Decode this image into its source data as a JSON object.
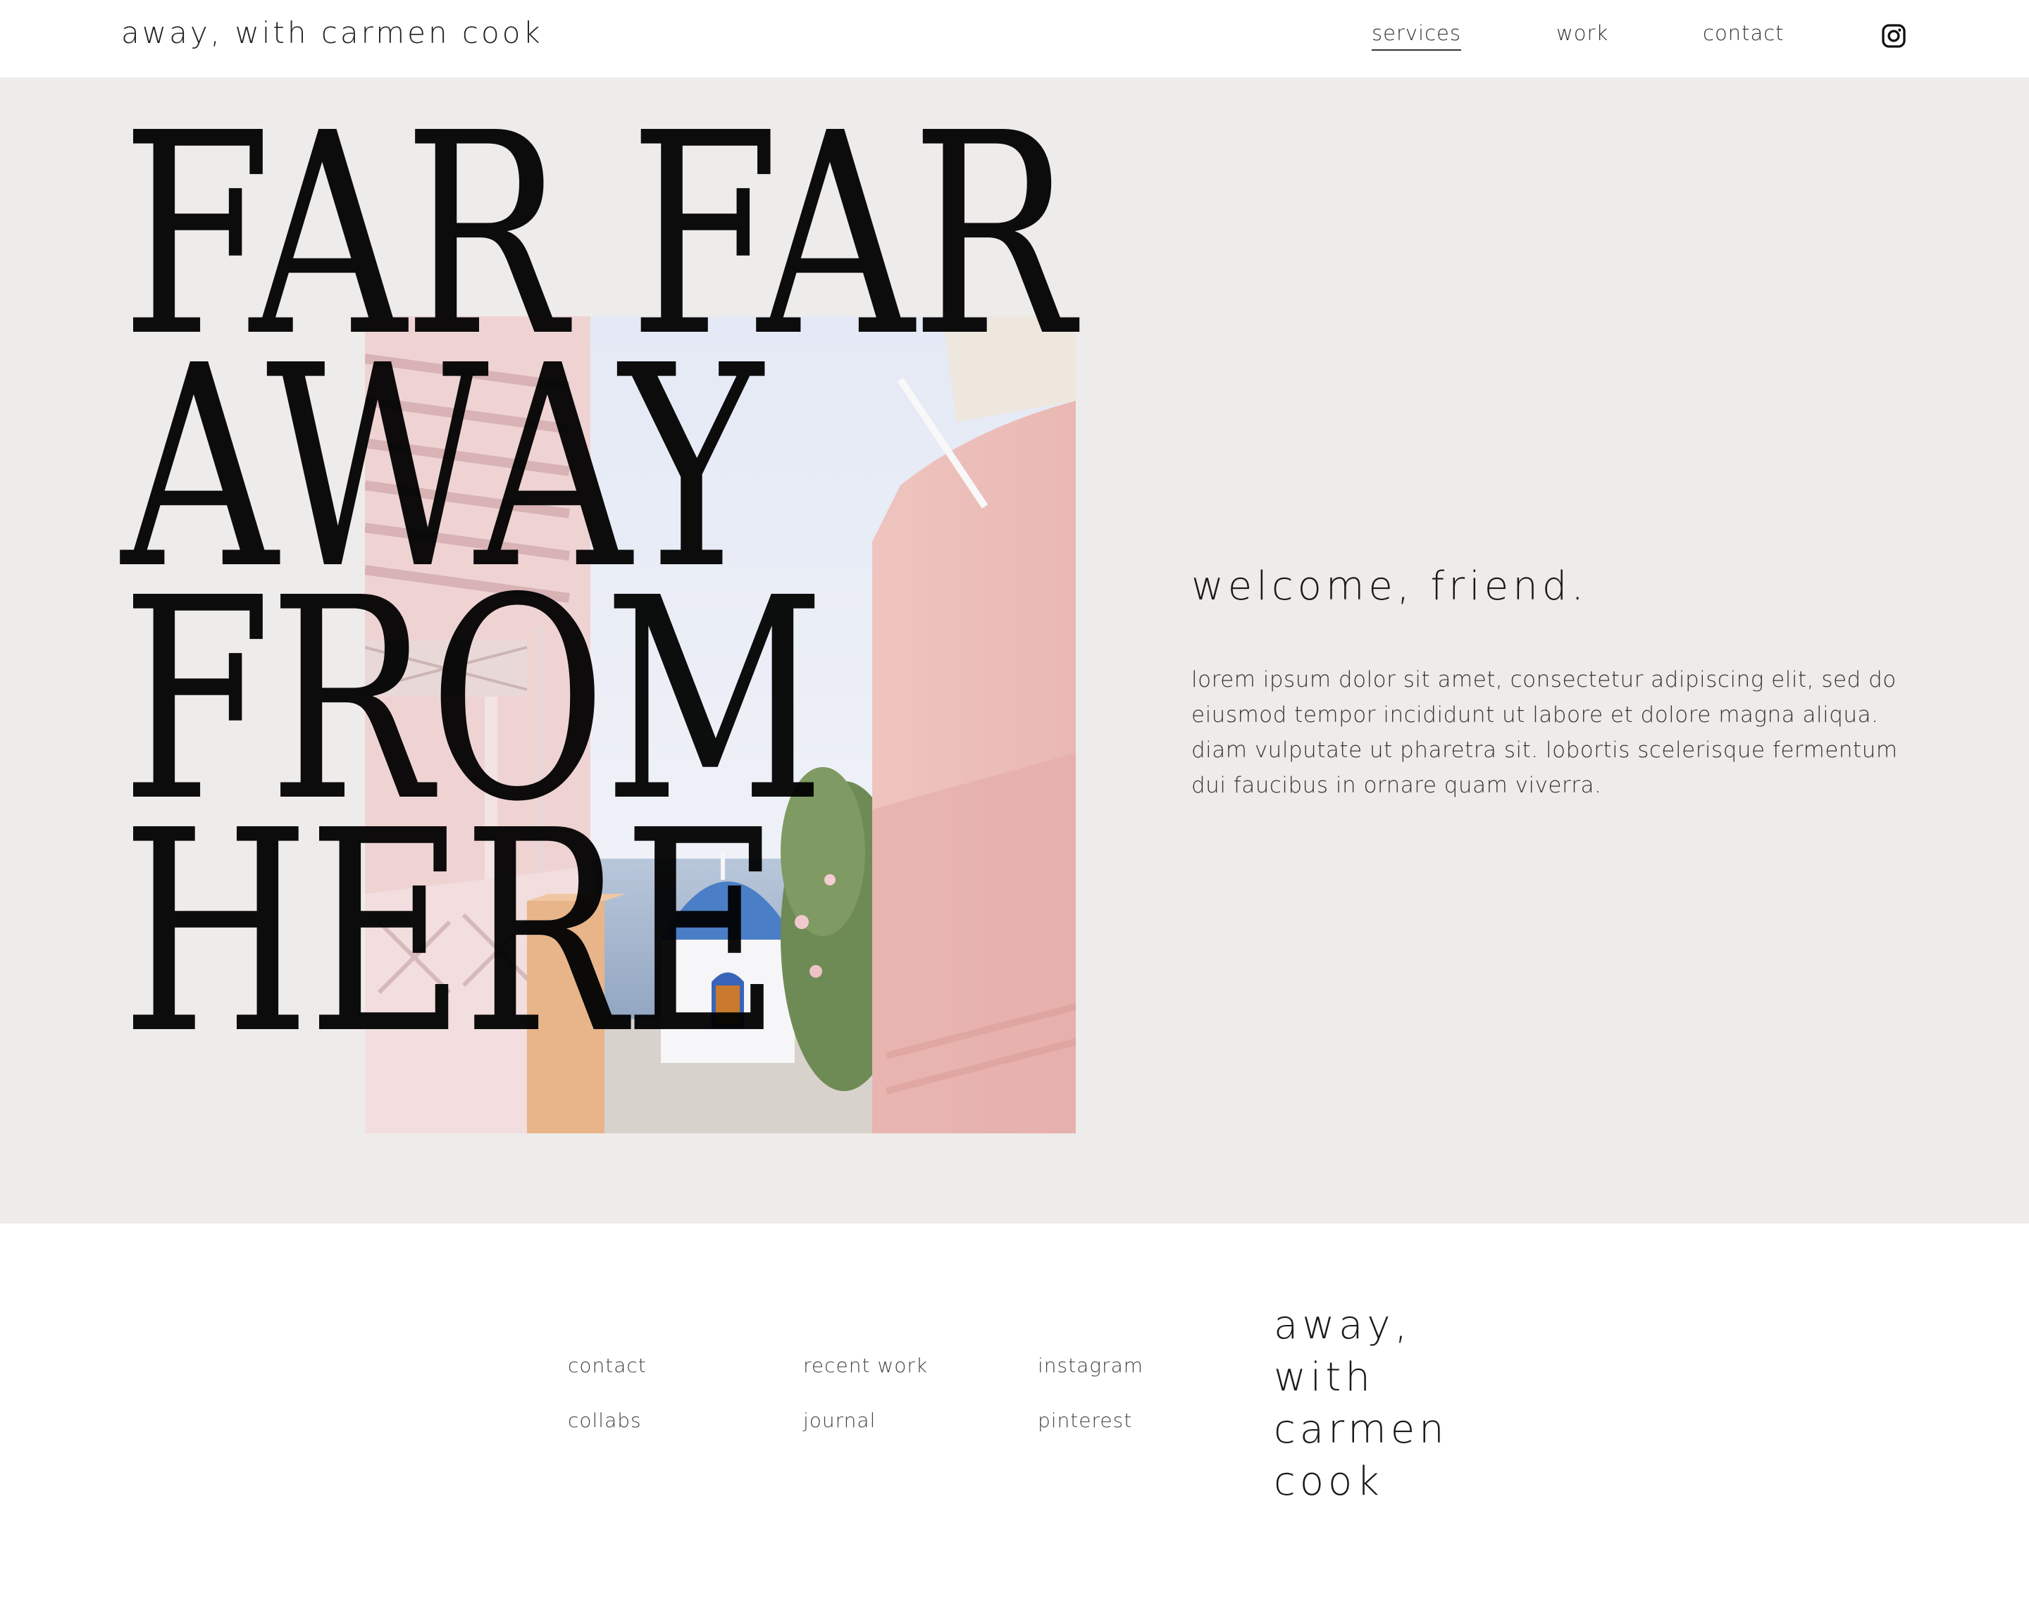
{
  "header": {
    "brand": "away, with carmen cook",
    "nav": [
      {
        "label": "services",
        "active": true
      },
      {
        "label": "work",
        "active": false
      },
      {
        "label": "contact",
        "active": false
      }
    ],
    "social_icon": "instagram-icon"
  },
  "hero": {
    "headline_lines": [
      "FAR FAR",
      "AWAY",
      "FROM",
      "HERE"
    ],
    "welcome": "welcome, friend.",
    "intro": "lorem ipsum dolor sit amet, consectetur adipiscing elit, sed do eiusmod tempor incididunt ut labore et dolore magna aliqua. diam vulputate ut pharetra sit. lobortis scelerisque fermentum dui faucibus in ornare quam viverra.",
    "background_color": "#eeecea"
  },
  "footer": {
    "links": [
      {
        "label": "contact"
      },
      {
        "label": "recent work"
      },
      {
        "label": "instagram"
      },
      {
        "label": "collabs"
      },
      {
        "label": "journal"
      },
      {
        "label": "pinterest"
      }
    ],
    "brand_lines": [
      "away,",
      "with",
      "carmen",
      "cook"
    ]
  }
}
